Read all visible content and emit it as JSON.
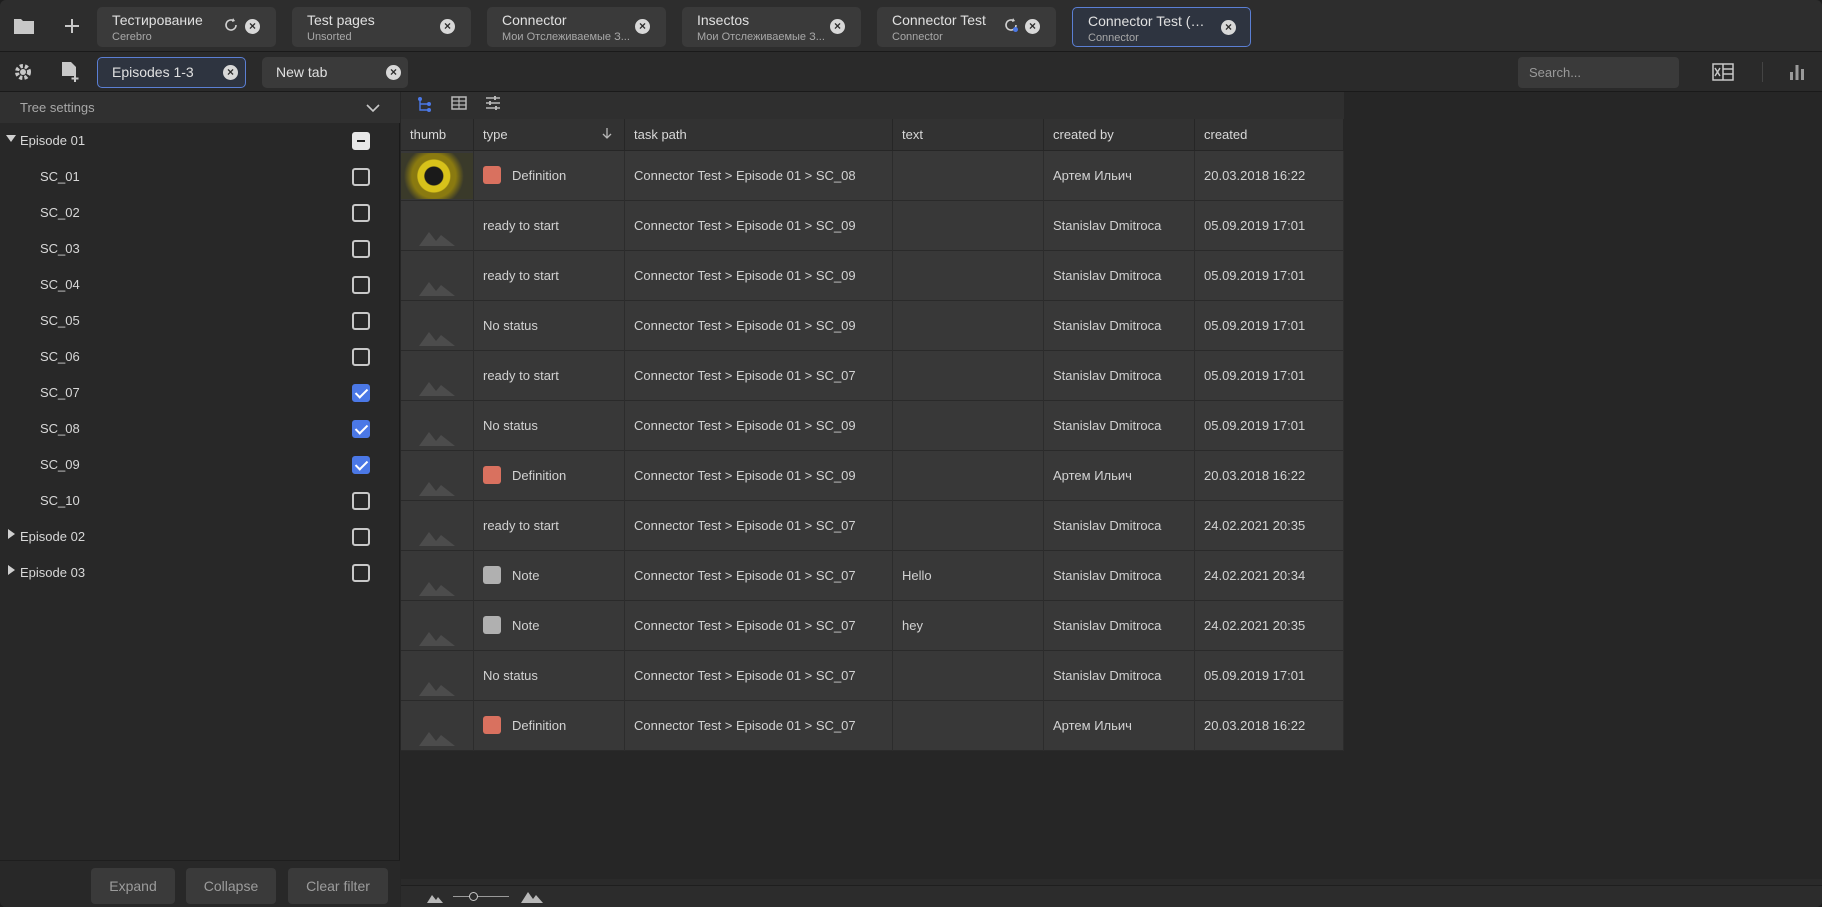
{
  "top_tabs": [
    {
      "title": "Тестирование",
      "subtitle": "Cerebro",
      "reload": true,
      "active": false
    },
    {
      "title": "Test pages",
      "subtitle": "Unsorted",
      "reload": false,
      "active": false
    },
    {
      "title": "Connector",
      "subtitle": "Мои Отслеживаемые З...",
      "reload": false,
      "active": false
    },
    {
      "title": "Insectos",
      "subtitle": "Мои Отслеживаемые З...",
      "reload": false,
      "active": false
    },
    {
      "title": "Connector Test",
      "subtitle": "Connector",
      "reload": true,
      "active": false
    },
    {
      "title": "Connector Test (Kon...",
      "subtitle": "Connector",
      "reload": false,
      "active": true
    }
  ],
  "icons": {
    "folder": "folder-icon",
    "add": "plus-icon",
    "settings": "gear-icon",
    "new_page": "add-document-icon",
    "excel": "excel-icon",
    "stats": "bar-chart-icon",
    "close": "close-icon",
    "reload": "reload-icon"
  },
  "local_tabs": [
    {
      "label": "Episodes 1-3",
      "active": true
    },
    {
      "label": "New tab",
      "active": false
    }
  ],
  "search": {
    "placeholder": "Search..."
  },
  "tree": {
    "header": "Tree settings",
    "items": [
      {
        "label": "Episode 01",
        "level": 0,
        "expanded": true,
        "state": "partial"
      },
      {
        "label": "SC_01",
        "level": 1,
        "state": "unchecked"
      },
      {
        "label": "SC_02",
        "level": 1,
        "state": "unchecked"
      },
      {
        "label": "SC_03",
        "level": 1,
        "state": "unchecked"
      },
      {
        "label": "SC_04",
        "level": 1,
        "state": "unchecked"
      },
      {
        "label": "SC_05",
        "level": 1,
        "state": "unchecked"
      },
      {
        "label": "SC_06",
        "level": 1,
        "state": "unchecked"
      },
      {
        "label": "SC_07",
        "level": 1,
        "state": "checked"
      },
      {
        "label": "SC_08",
        "level": 1,
        "state": "checked"
      },
      {
        "label": "SC_09",
        "level": 1,
        "state": "checked"
      },
      {
        "label": "SC_10",
        "level": 1,
        "state": "unchecked"
      },
      {
        "label": "Episode 02",
        "level": 0,
        "expanded": false,
        "state": "unchecked"
      },
      {
        "label": "Episode 03",
        "level": 0,
        "expanded": false,
        "state": "unchecked"
      }
    ],
    "buttons": {
      "expand": "Expand",
      "collapse": "Collapse",
      "clear": "Clear filter"
    }
  },
  "colors": {
    "accent": "#4b78e6",
    "definition": "#d9715f",
    "note": "#b0b0b0"
  },
  "table": {
    "columns": [
      "thumb",
      "type",
      "task path",
      "text",
      "created by",
      "created"
    ],
    "sort_column": "type",
    "rows": [
      {
        "thumb": true,
        "type": "Definition",
        "swatch": "#d9715f",
        "path": "Connector Test > Episode 01 > SC_08",
        "text": "",
        "by": "Артем Ильич",
        "created": "20.03.2018 16:22"
      },
      {
        "thumb": false,
        "type": "ready to start",
        "swatch": "",
        "path": "Connector Test > Episode 01 > SC_09",
        "text": "",
        "by": "Stanislav Dmitroca",
        "created": "05.09.2019 17:01"
      },
      {
        "thumb": false,
        "type": "ready to start",
        "swatch": "",
        "path": "Connector Test > Episode 01 > SC_09",
        "text": "",
        "by": "Stanislav Dmitroca",
        "created": "05.09.2019 17:01"
      },
      {
        "thumb": false,
        "type": "No status",
        "swatch": "",
        "path": "Connector Test > Episode 01 > SC_09",
        "text": "",
        "by": "Stanislav Dmitroca",
        "created": "05.09.2019 17:01"
      },
      {
        "thumb": false,
        "type": "ready to start",
        "swatch": "",
        "path": "Connector Test > Episode 01 > SC_07",
        "text": "",
        "by": "Stanislav Dmitroca",
        "created": "05.09.2019 17:01"
      },
      {
        "thumb": false,
        "type": "No status",
        "swatch": "",
        "path": "Connector Test > Episode 01 > SC_09",
        "text": "",
        "by": "Stanislav Dmitroca",
        "created": "05.09.2019 17:01"
      },
      {
        "thumb": false,
        "type": "Definition",
        "swatch": "#d9715f",
        "path": "Connector Test > Episode 01 > SC_09",
        "text": "",
        "by": "Артем Ильич",
        "created": "20.03.2018 16:22"
      },
      {
        "thumb": false,
        "type": "ready to start",
        "swatch": "",
        "path": "Connector Test > Episode 01 > SC_07",
        "text": "",
        "by": "Stanislav Dmitroca",
        "created": "24.02.2021 20:35"
      },
      {
        "thumb": false,
        "type": "Note",
        "swatch": "#b0b0b0",
        "path": "Connector Test > Episode 01 > SC_07",
        "text": "Hello",
        "by": "Stanislav Dmitroca",
        "created": "24.02.2021 20:34"
      },
      {
        "thumb": false,
        "type": "Note",
        "swatch": "#b0b0b0",
        "path": "Connector Test > Episode 01 > SC_07",
        "text": "hey",
        "by": "Stanislav Dmitroca",
        "created": "24.02.2021 20:35"
      },
      {
        "thumb": false,
        "type": "No status",
        "swatch": "",
        "path": "Connector Test > Episode 01 > SC_07",
        "text": "",
        "by": "Stanislav Dmitroca",
        "created": "05.09.2019 17:01"
      },
      {
        "thumb": false,
        "type": "Definition",
        "swatch": "#d9715f",
        "path": "Connector Test > Episode 01 > SC_07",
        "text": "",
        "by": "Артем Ильич",
        "created": "20.03.2018 16:22"
      }
    ]
  },
  "thumb_size": {
    "label": "thumbnail-size-slider",
    "level": 0.35
  }
}
